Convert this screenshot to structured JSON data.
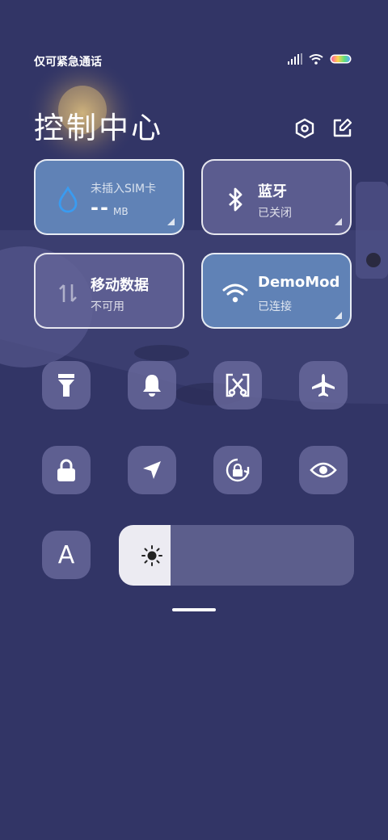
{
  "status": {
    "carrier_text": "仅可紧急通话",
    "icons": [
      "signal-icon",
      "wifi-icon",
      "battery-icon"
    ]
  },
  "header": {
    "title": "控制中心",
    "icons": [
      "settings-icon",
      "edit-icon"
    ]
  },
  "tiles": {
    "data_usage": {
      "name": "未插入SIM卡",
      "value": "--",
      "unit": "MB",
      "icon": "water-drop-icon",
      "state": "active"
    },
    "bluetooth": {
      "name": "蓝牙",
      "status": "已关闭",
      "icon": "bluetooth-icon",
      "state": "inactive"
    },
    "mobile_data": {
      "name": "移动数据",
      "status": "不可用",
      "icon": "data-arrows-icon",
      "state": "inactive"
    },
    "wifi": {
      "name": "DemoMode",
      "status": "已连接",
      "icon": "wifi-icon",
      "state": "active"
    }
  },
  "toggles": [
    {
      "name": "flashlight",
      "icon": "flashlight-icon"
    },
    {
      "name": "ring",
      "icon": "bell-icon"
    },
    {
      "name": "screenshot",
      "icon": "scissors-icon"
    },
    {
      "name": "airplane",
      "icon": "airplane-icon"
    },
    {
      "name": "lock",
      "icon": "lock-icon"
    },
    {
      "name": "location",
      "icon": "location-arrow-icon"
    },
    {
      "name": "rotation-lock",
      "icon": "rotation-lock-icon"
    },
    {
      "name": "reading-mode",
      "icon": "eye-icon"
    },
    {
      "name": "auto-brightness",
      "icon": "letter-a-icon",
      "label": "A"
    }
  ],
  "brightness": {
    "level": 0.22,
    "icon": "sun-icon"
  },
  "colors": {
    "background": "#323566",
    "tile_active": "#6082b6",
    "tile_inactive": "#636396",
    "accent_blue": "#3a9bf0"
  }
}
